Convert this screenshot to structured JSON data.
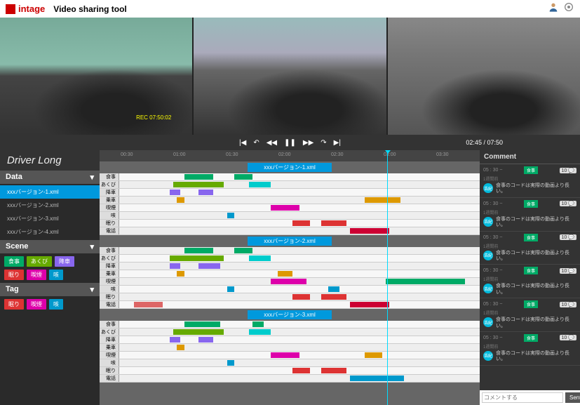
{
  "app": {
    "brand": "intage",
    "title": "Video sharing tool"
  },
  "video": {
    "overlay": "REC 07:50:02"
  },
  "player": {
    "current": "02:45",
    "total": "07:50"
  },
  "sidebar": {
    "title": "Driver Long",
    "data_label": "Data",
    "data_items": [
      "xxxバージョン-1.xml",
      "xxxバージョン-2.xml",
      "xxxバージョン-3.xml",
      "xxxバージョン-4.xml"
    ],
    "scene_label": "Scene",
    "scenes": [
      {
        "label": "食事",
        "color": "#0a6"
      },
      {
        "label": "あくび",
        "color": "#6a0"
      },
      {
        "label": "降車",
        "color": "#86e"
      },
      {
        "label": "眠り",
        "color": "#d33"
      },
      {
        "label": "喫煙",
        "color": "#d0a"
      },
      {
        "label": "咳",
        "color": "#09c"
      }
    ],
    "tag_label": "Tag",
    "tags": [
      {
        "label": "眠り",
        "color": "#d33"
      },
      {
        "label": "喫煙",
        "color": "#d0a"
      },
      {
        "label": "咳",
        "color": "#09c"
      }
    ]
  },
  "ruler": [
    "00:30",
    "01:00",
    "01:30",
    "02:00",
    "02:30",
    "03:00",
    "03:30"
  ],
  "groups": [
    {
      "name": "xxxバージョン-1.xml",
      "rows": [
        {
          "label": "食事",
          "segs": [
            {
              "l": 18,
              "w": 8,
              "c": "#0a6"
            },
            {
              "l": 32,
              "w": 5,
              "c": "#0a6"
            }
          ]
        },
        {
          "label": "あくび",
          "segs": [
            {
              "l": 15,
              "w": 14,
              "c": "#6a0"
            },
            {
              "l": 36,
              "w": 6,
              "c": "#0cc"
            }
          ]
        },
        {
          "label": "降車",
          "segs": [
            {
              "l": 14,
              "w": 3,
              "c": "#86e"
            },
            {
              "l": 22,
              "w": 4,
              "c": "#86e"
            }
          ]
        },
        {
          "label": "乗車",
          "segs": [
            {
              "l": 16,
              "w": 2,
              "c": "#d90"
            },
            {
              "l": 68,
              "w": 10,
              "c": "#d90"
            }
          ]
        },
        {
          "label": "喫煙",
          "segs": [
            {
              "l": 42,
              "w": 8,
              "c": "#d0a"
            }
          ]
        },
        {
          "label": "咳",
          "segs": [
            {
              "l": 30,
              "w": 2,
              "c": "#09c"
            }
          ]
        },
        {
          "label": "眠り",
          "segs": [
            {
              "l": 48,
              "w": 5,
              "c": "#d33"
            },
            {
              "l": 56,
              "w": 7,
              "c": "#d33"
            }
          ]
        },
        {
          "label": "電話",
          "segs": [
            {
              "l": 64,
              "w": 11,
              "c": "#c03"
            }
          ]
        }
      ]
    },
    {
      "name": "xxxバージョン-2.xml",
      "rows": [
        {
          "label": "食事",
          "segs": [
            {
              "l": 18,
              "w": 8,
              "c": "#0a6"
            },
            {
              "l": 32,
              "w": 5,
              "c": "#0a6"
            }
          ]
        },
        {
          "label": "あくび",
          "segs": [
            {
              "l": 14,
              "w": 15,
              "c": "#6a0"
            },
            {
              "l": 36,
              "w": 6,
              "c": "#0cc"
            }
          ]
        },
        {
          "label": "降車",
          "segs": [
            {
              "l": 14,
              "w": 3,
              "c": "#86e"
            },
            {
              "l": 22,
              "w": 4,
              "c": "#86e"
            },
            {
              "l": 26,
              "w": 2,
              "c": "#86e"
            }
          ]
        },
        {
          "label": "乗車",
          "segs": [
            {
              "l": 16,
              "w": 2,
              "c": "#d90"
            },
            {
              "l": 44,
              "w": 4,
              "c": "#d90"
            }
          ]
        },
        {
          "label": "喫煙",
          "segs": [
            {
              "l": 42,
              "w": 10,
              "c": "#d0a"
            },
            {
              "l": 74,
              "w": 22,
              "c": "#0a6"
            }
          ]
        },
        {
          "label": "咳",
          "segs": [
            {
              "l": 30,
              "w": 2,
              "c": "#09c"
            },
            {
              "l": 58,
              "w": 3,
              "c": "#09c"
            }
          ]
        },
        {
          "label": "眠り",
          "segs": [
            {
              "l": 48,
              "w": 5,
              "c": "#d33"
            },
            {
              "l": 56,
              "w": 7,
              "c": "#d33"
            }
          ]
        },
        {
          "label": "電話",
          "segs": [
            {
              "l": 4,
              "w": 8,
              "c": "#d66"
            },
            {
              "l": 64,
              "w": 11,
              "c": "#c03"
            }
          ]
        }
      ]
    },
    {
      "name": "xxxバージョン-3.xml",
      "rows": [
        {
          "label": "食事",
          "segs": [
            {
              "l": 18,
              "w": 10,
              "c": "#0a6"
            },
            {
              "l": 37,
              "w": 3,
              "c": "#0a6"
            }
          ]
        },
        {
          "label": "あくび",
          "segs": [
            {
              "l": 15,
              "w": 14,
              "c": "#6a0"
            },
            {
              "l": 36,
              "w": 6,
              "c": "#0cc"
            }
          ]
        },
        {
          "label": "降車",
          "segs": [
            {
              "l": 14,
              "w": 3,
              "c": "#86e"
            },
            {
              "l": 22,
              "w": 4,
              "c": "#86e"
            }
          ]
        },
        {
          "label": "乗車",
          "segs": [
            {
              "l": 16,
              "w": 2,
              "c": "#d90"
            }
          ]
        },
        {
          "label": "喫煙",
          "segs": [
            {
              "l": 42,
              "w": 8,
              "c": "#d0a"
            },
            {
              "l": 68,
              "w": 5,
              "c": "#d90"
            }
          ]
        },
        {
          "label": "咳",
          "segs": [
            {
              "l": 30,
              "w": 2,
              "c": "#09c"
            }
          ]
        },
        {
          "label": "眠り",
          "segs": [
            {
              "l": 48,
              "w": 5,
              "c": "#d33"
            },
            {
              "l": 56,
              "w": 7,
              "c": "#d33"
            }
          ]
        },
        {
          "label": "電話",
          "segs": [
            {
              "l": 64,
              "w": 15,
              "c": "#09c"
            }
          ]
        }
      ]
    }
  ],
  "comments": {
    "title": "Comment",
    "items": [
      {
        "time": "05 : 30 ~",
        "tag": "食事",
        "count": "10",
        "ts": "1週間前",
        "user": "浩紀",
        "text": "食事のコードは実際の動画より長い。"
      },
      {
        "time": "05 : 30 ~",
        "tag": "食事",
        "count": "10",
        "ts": "1週間前",
        "user": "浩紀",
        "text": "食事のコードは実際の動画より長い。"
      },
      {
        "time": "05 : 30 ~",
        "tag": "食事",
        "count": "10",
        "ts": "1週間前",
        "user": "浩紀",
        "text": "食事のコードは実際の動画より長い。"
      },
      {
        "time": "05 : 30 ~",
        "tag": "食事",
        "count": "10",
        "ts": "1週間前",
        "user": "浩紀",
        "text": "食事のコードは実際の動画より長い。"
      },
      {
        "time": "05 : 30 ~",
        "tag": "食事",
        "count": "10",
        "ts": "1週間前",
        "user": "浩紀",
        "text": "食事のコードは実際の動画より長い。"
      },
      {
        "time": "05 : 30 ~",
        "tag": "食事",
        "count": "10",
        "ts": "1週間前",
        "user": "浩紀",
        "text": "食事のコードは実際の動画より長い。"
      }
    ],
    "placeholder": "コメントする",
    "send": "Sent"
  }
}
